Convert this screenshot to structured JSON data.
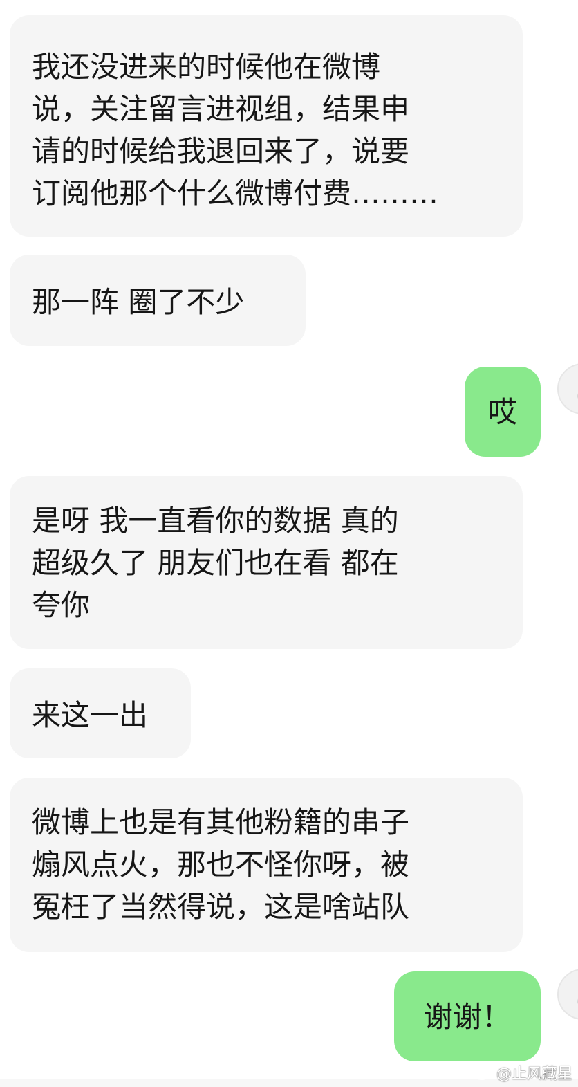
{
  "messages": [
    {
      "sender": "other",
      "text": "我还没进来的时候他在微博\n说，关注留言进视组，结果申\n请的时候给我退回来了，说要\n订阅他那个什么微博付费………"
    },
    {
      "sender": "other",
      "text": "那一阵 圈了不少"
    },
    {
      "sender": "me",
      "text": "哎"
    },
    {
      "sender": "other",
      "text": "是呀 我一直看你的数据 真的\n超级久了 朋友们也在看 都在\n夸你"
    },
    {
      "sender": "other",
      "text": "来这一出"
    },
    {
      "sender": "other",
      "text": "微博上也是有其他粉籍的串子\n煽风点火，那也不怪你呀，被\n冤枉了当然得说，这是啥站队"
    },
    {
      "sender": "me",
      "text": "谢谢！"
    }
  ],
  "watermark": {
    "text": "@止风藏星",
    "icon": "weibo-icon"
  },
  "colors": {
    "incoming_bubble": "#f5f5f5",
    "outgoing_bubble": "#89e98c",
    "background": "#ffffff",
    "text": "#161616"
  }
}
